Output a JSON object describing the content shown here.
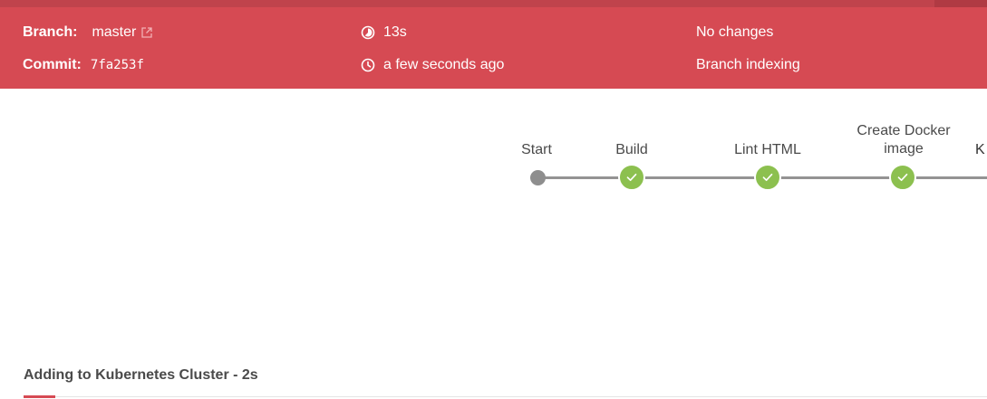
{
  "header": {
    "branch_label": "Branch:",
    "branch_value": "master",
    "commit_label": "Commit:",
    "commit_value": "7fa253f",
    "duration": "13s",
    "time_ago": "a few seconds ago",
    "changes": "No changes",
    "cause": "Branch indexing",
    "icons": [
      "external-link-icon",
      "duration-icon",
      "clock-icon"
    ]
  },
  "pipeline": {
    "stages": [
      {
        "label": "Start",
        "status": "start"
      },
      {
        "label": "Build",
        "status": "success"
      },
      {
        "label": "Lint HTML",
        "status": "success"
      },
      {
        "label": "Create Docker",
        "label_line2": "image",
        "status": "success"
      },
      {
        "label": "K",
        "status": "partial"
      }
    ]
  },
  "selected_stage": {
    "title": "Adding to Kubernetes Cluster - 2s"
  },
  "colors": {
    "header_bg": "#d64a53",
    "header_strip": "#c0434c",
    "success": "#8cc04f",
    "track": "#949393",
    "start_dot": "#8e8e8e",
    "text": "#4a4a4a"
  }
}
